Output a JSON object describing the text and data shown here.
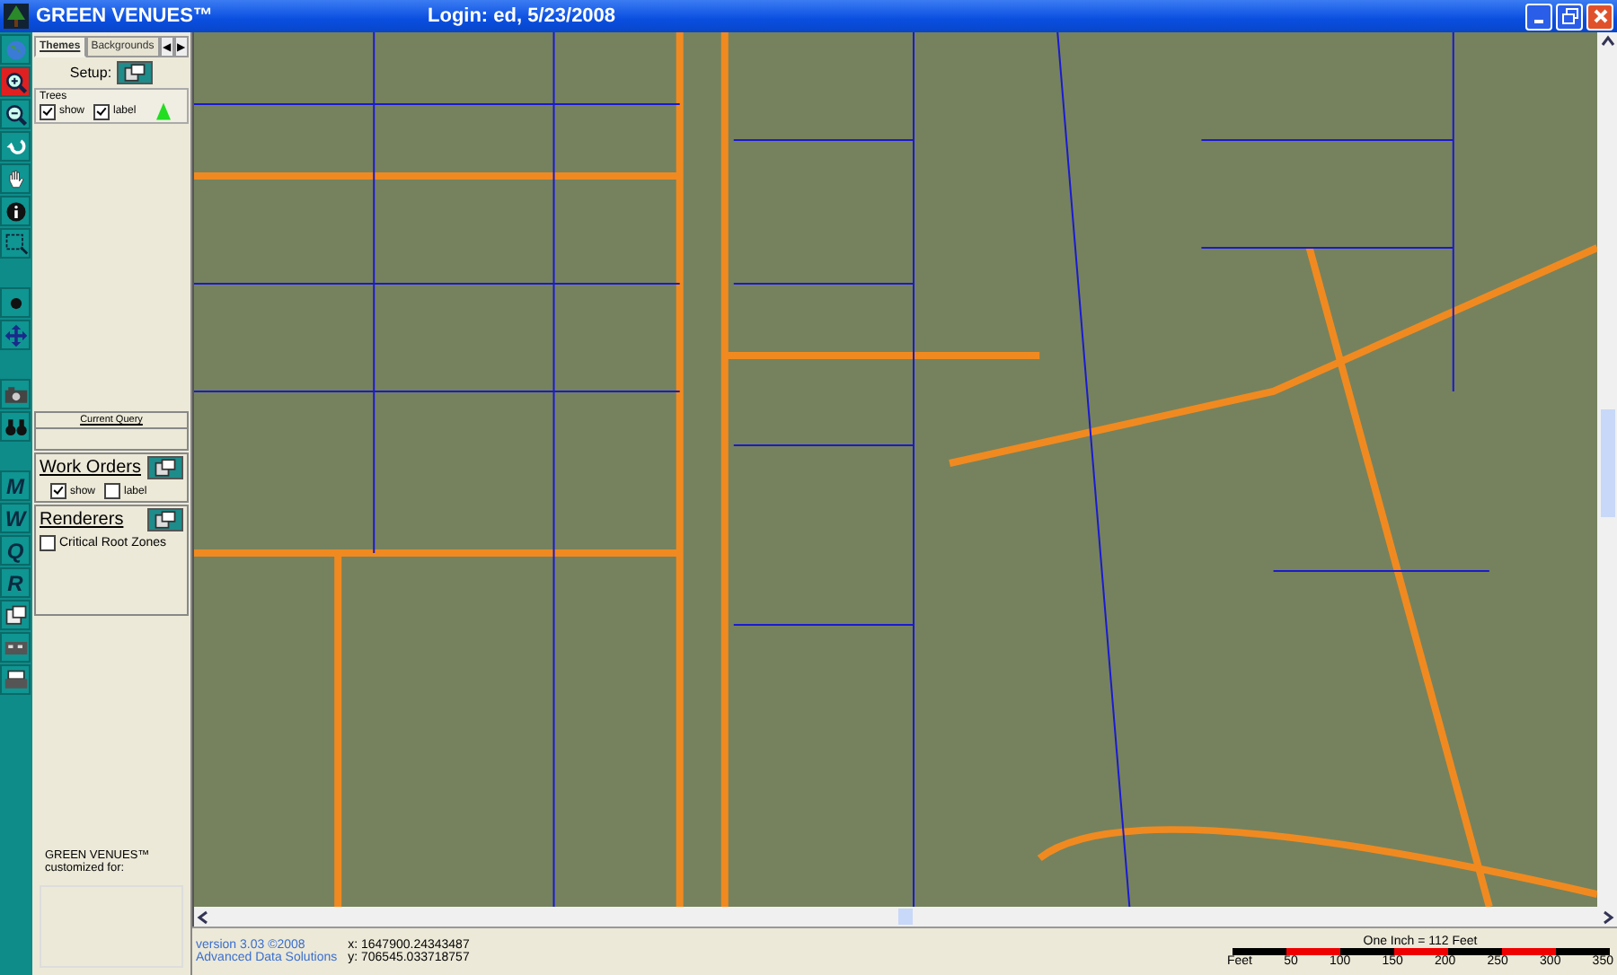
{
  "window": {
    "app_name": "GREEN VENUES™",
    "title": "Login: ed, 5/23/2008"
  },
  "tools": [
    {
      "selected": false
    },
    {
      "selected": true
    },
    {
      "selected": false
    },
    {
      "selected": false
    },
    {
      "selected": false
    },
    {
      "selected": false
    },
    {
      "selected": false
    },
    {
      "selected": false
    },
    {
      "selected": false
    },
    {
      "selected": false
    },
    {
      "selected": false
    },
    {
      "selected": false,
      "label": "M"
    },
    {
      "selected": false,
      "label": "W"
    },
    {
      "selected": false,
      "label": "Q"
    },
    {
      "selected": false,
      "label": "R"
    },
    {
      "selected": false
    },
    {
      "selected": false
    },
    {
      "selected": false
    }
  ],
  "tabs": [
    {
      "label": "Themes",
      "selected": true
    },
    {
      "label": "Backgrounds",
      "selected": false
    }
  ],
  "tab_arrows": [
    "◀",
    "▶"
  ],
  "setup_label": "Setup:",
  "trees": {
    "title": "Trees",
    "show": {
      "label": "show",
      "checked": true
    },
    "label": {
      "label": "label",
      "checked": true
    }
  },
  "current_query": "Current Query",
  "work_orders": {
    "title": "Work Orders",
    "show": {
      "label": "show",
      "checked": true
    },
    "label": {
      "label": "label",
      "checked": false
    }
  },
  "renderers": {
    "title": "Renderers",
    "items": [
      {
        "label": "Critical Root Zones",
        "checked": false
      }
    ]
  },
  "footer": [
    "GREEN VENUES™",
    "customized for:"
  ],
  "status": {
    "version": "version 3.03 ©2008",
    "company": "Advanced Data Solutions",
    "x": "x: 1647900.24343487",
    "y": "y: 706545.033718757"
  },
  "scale": {
    "title": "One Inch = 112 Feet",
    "unit": "Feet",
    "ticks": [
      "50",
      "100",
      "150",
      "200",
      "250",
      "300",
      "350"
    ]
  }
}
